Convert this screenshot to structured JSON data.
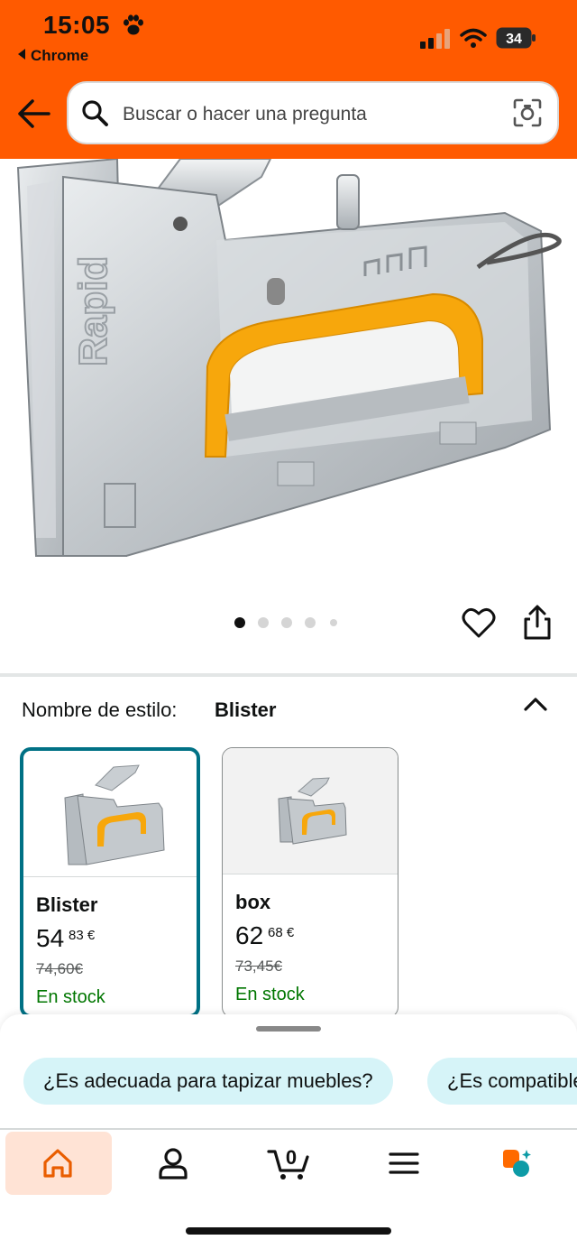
{
  "status_bar": {
    "time": "15:05",
    "back_app": "Chrome",
    "battery": "34"
  },
  "search": {
    "placeholder": "Buscar o hacer una pregunta"
  },
  "style_selector": {
    "label": "Nombre de estilo:",
    "value": "Blister"
  },
  "variants": [
    {
      "name": "Blister",
      "price_whole": "54",
      "price_fraction": "83 €",
      "old_price": "74,60€",
      "stock": "En stock",
      "selected": true
    },
    {
      "name": "box",
      "price_whole": "62",
      "price_fraction": "68 €",
      "old_price": "73,45€",
      "stock": "En stock",
      "selected": false
    }
  ],
  "carousel": {
    "pages": 5,
    "active": 1
  },
  "suggestions": [
    "¿Es adecuada para tapizar muebles?",
    "¿Es compatible"
  ],
  "nav": {
    "cart_count": "0",
    "items": [
      "home-icon",
      "account-icon",
      "cart-icon",
      "menu-icon",
      "rufus-icon"
    ]
  },
  "colors": {
    "brand_orange": "#ff5a00",
    "selected_border": "#007185",
    "in_stock": "#007600",
    "chip_bg": "#d6f4f8"
  }
}
